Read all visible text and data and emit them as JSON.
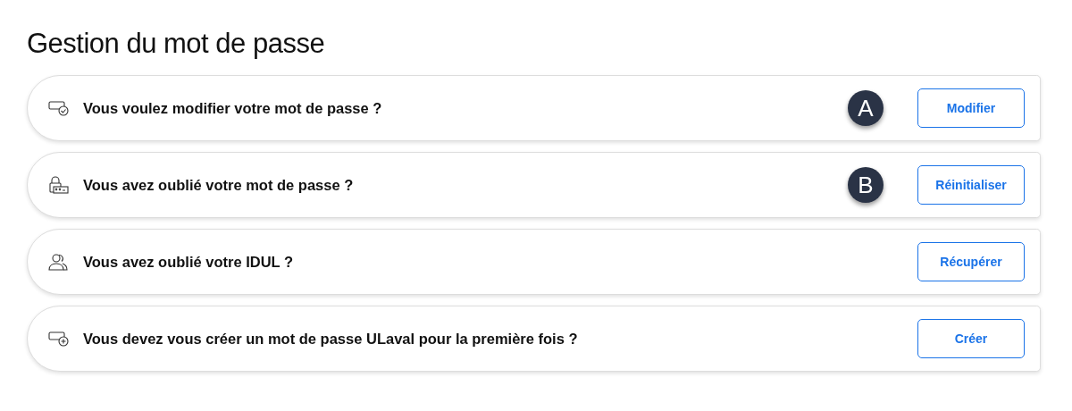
{
  "title": "Gestion du mot de passe",
  "items": [
    {
      "kind": "password-check",
      "question": "Vous voulez modifier votre mot de passe ?",
      "marker": "A",
      "button": "Modifier"
    },
    {
      "kind": "lock-password",
      "question": "Vous avez oublié votre mot de passe ?",
      "marker": "B",
      "button": "Réinitialiser"
    },
    {
      "kind": "users",
      "question": "Vous avez oublié votre IDUL ?",
      "button": "Récupérer"
    },
    {
      "kind": "password-add",
      "question": "Vous devez vous créer un mot de passe ULaval pour la première fois ?",
      "button": "Créer"
    }
  ]
}
